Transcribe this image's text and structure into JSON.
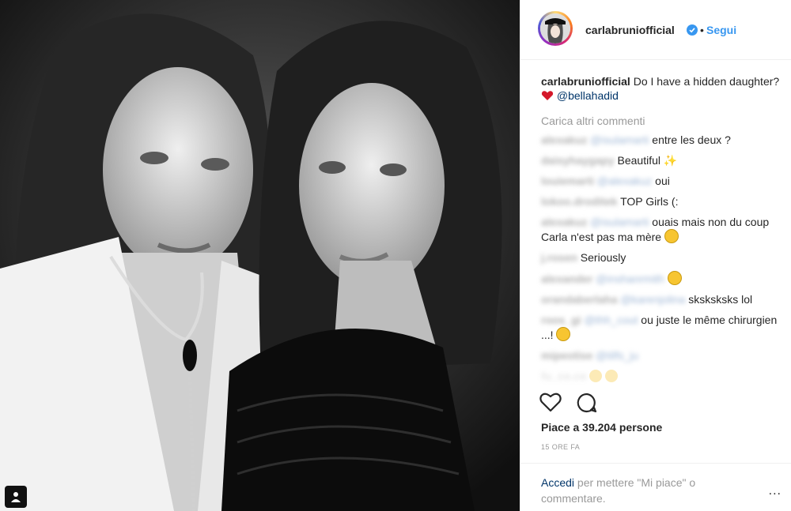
{
  "header": {
    "username": "carlabruniofficial",
    "separator": "•",
    "follow_label": "Segui"
  },
  "caption": {
    "username": "carlabruniofficial",
    "text": "Do I have a hidden daughter?",
    "mention": "@bellahadid"
  },
  "load_more": "Carica altri commenti",
  "comments": [
    {
      "user": "alexakuz",
      "mention": "@isulamarti",
      "text": "entre les deux ?"
    },
    {
      "user": "daisyhaygapy",
      "text": "Beautiful"
    },
    {
      "user": "louiemarti",
      "mention": "@alexakuz",
      "text": "oui"
    },
    {
      "user": "lokoo.droditek",
      "text": "TOP Girls (:"
    },
    {
      "user": "alexakuz",
      "mention": "@isulamarti",
      "text": "ouais mais non du coup Carla n'est pas ma mère"
    },
    {
      "user": "j.rosen",
      "text": "Seriously"
    },
    {
      "user": "alexander",
      "mention": "@inshanrmith",
      "text": ""
    },
    {
      "user": "orandaberlaha",
      "mention": "@karenjolina",
      "text": "sksksksks lol"
    },
    {
      "user": "roos_gi",
      "mention": "@thh_cout",
      "text": "ou juste le même chirurgien ...!"
    },
    {
      "user": "mipeotise",
      "mention": "@tilfs_ju",
      "text": ""
    },
    {
      "user": "fu_co.co",
      "text": ""
    }
  ],
  "likes": "Piace a 39.204 persone",
  "timestamp": "15 ORE FA",
  "login_prompt": {
    "link": "Accedi",
    "text": "per mettere \"Mi piace\" o commentare."
  },
  "more_options": "..."
}
